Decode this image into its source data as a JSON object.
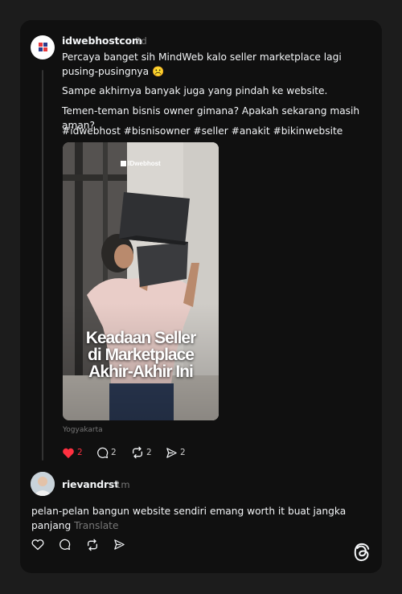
{
  "post": {
    "username": "idwebhostcom",
    "time": "3d",
    "paragraphs": [
      "Percaya banget sih MindWeb kalo seller marketplace lagi pusing-pusingnya ☹️",
      "Sampe akhirnya banyak juga yang pindah ke website.",
      "Temen-teman bisnis owner gimana? Apakah sekarang masih aman?",
      "#idwebhost #bisnisowner #seller #anakit #bikinwebsite"
    ],
    "media": {
      "brand": "IDwebhost",
      "title_lines": [
        "Keadaan Seller",
        "di Marketplace",
        "Akhir-Akhir Ini"
      ]
    },
    "location": "Yogyakarta",
    "actions": {
      "likes": "2",
      "comments": "2",
      "reposts": "2",
      "shares": "2"
    }
  },
  "reply": {
    "username": "rievandrst",
    "time": "1m",
    "text": "pelan-pelan bangun website sendiri emang worth it buat jangka panjang",
    "translate_label": "Translate"
  },
  "icons": {
    "like": "heart-icon",
    "comment": "comment-icon",
    "repost": "repost-icon",
    "share": "share-icon",
    "app": "threads-logo-icon"
  },
  "colors": {
    "background": "#1c1c1c",
    "card": "#101010",
    "liked": "#ff3040",
    "muted": "#777777"
  }
}
